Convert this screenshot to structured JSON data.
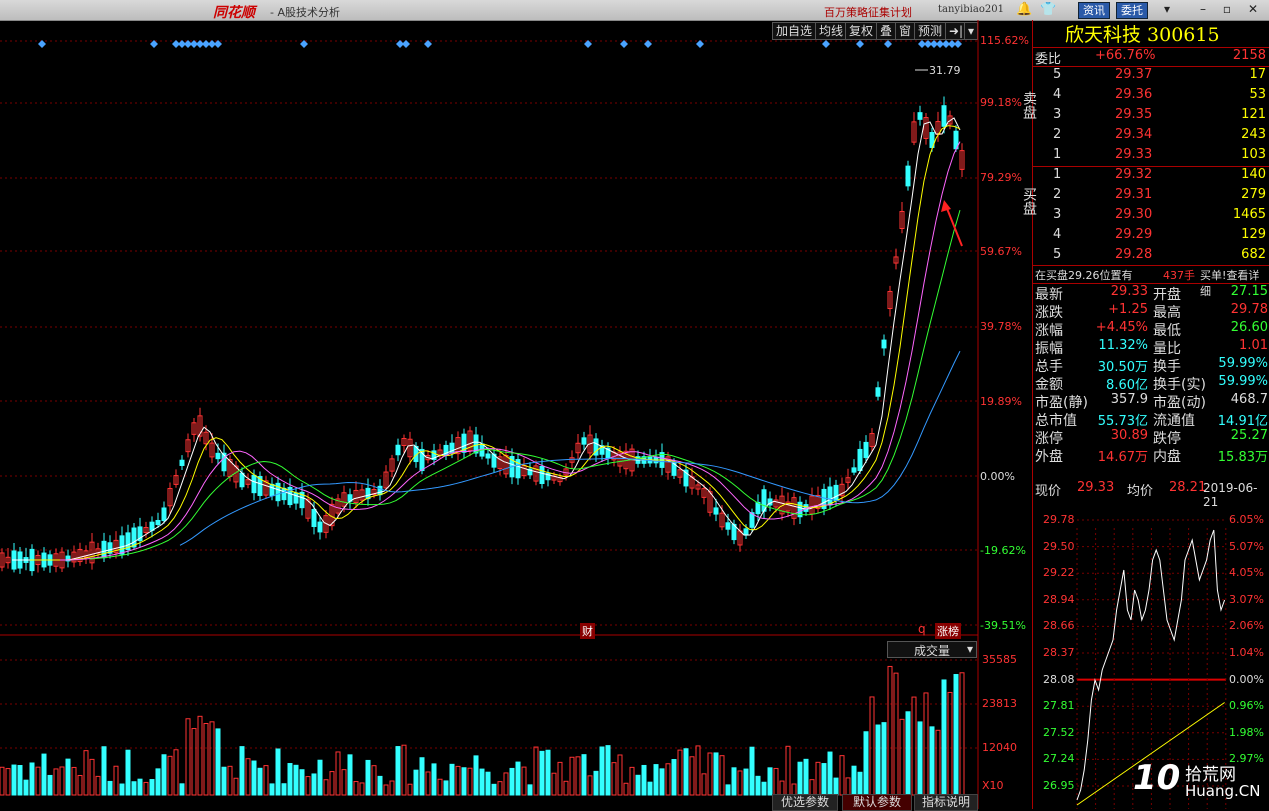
{
  "titlebar": {
    "brand": "同花顺",
    "app": "- A股技术分析",
    "promo": "百万策略征集计划",
    "user": "tanyibiao201",
    "btn_news": "资讯",
    "btn_order": "委托"
  },
  "toolbar": {
    "add_watch": "加自选",
    "ma": "均线",
    "restore": "复权",
    "overlay": "叠",
    "window": "窗",
    "forecast": "预测"
  },
  "main": {
    "pct_labels": [
      "115.62%",
      "99.18%",
      "79.29%",
      "59.67%",
      "39.78%",
      "19.89%",
      "0.00%",
      "-19.62%",
      "-39.51%"
    ],
    "high_label": "31.79",
    "marker_cai": "财",
    "marker_q": "q",
    "marker_zb": "涨榜"
  },
  "volume": {
    "selector": "成交量",
    "labels": [
      "35585",
      "23813",
      "12040"
    ],
    "unit": "X10"
  },
  "tabs": [
    "优选参数",
    "默认参数",
    "指标说明"
  ],
  "quote": {
    "name": "欣天科技 300615",
    "weibi_label": "委比",
    "weibi_pct": "+66.76%",
    "weibi_val": "2158",
    "sell_label": "卖盘",
    "buy_label": "买盘",
    "sells": [
      {
        "lv": "5",
        "price": "29.37",
        "vol": "17"
      },
      {
        "lv": "4",
        "price": "29.36",
        "vol": "53"
      },
      {
        "lv": "3",
        "price": "29.35",
        "vol": "121"
      },
      {
        "lv": "2",
        "price": "29.34",
        "vol": "243"
      },
      {
        "lv": "1",
        "price": "29.33",
        "vol": "103"
      }
    ],
    "buys": [
      {
        "lv": "1",
        "price": "29.32",
        "vol": "140"
      },
      {
        "lv": "2",
        "price": "29.31",
        "vol": "279"
      },
      {
        "lv": "3",
        "price": "29.30",
        "vol": "1465"
      },
      {
        "lv": "4",
        "price": "29.29",
        "vol": "129"
      },
      {
        "lv": "5",
        "price": "29.28",
        "vol": "682"
      }
    ],
    "notice": "在买盘29.26位置有",
    "notice_vol": "437手",
    "notice_action": "买单!查看详细",
    "stats": [
      {
        "k1": "最新",
        "v1": "29.33",
        "c1": "red",
        "k2": "开盘",
        "v2": "27.15",
        "c2": "grn"
      },
      {
        "k1": "涨跌",
        "v1": "+1.25",
        "c1": "red",
        "k2": "最高",
        "v2": "29.78",
        "c2": "red"
      },
      {
        "k1": "涨幅",
        "v1": "+4.45%",
        "c1": "red",
        "k2": "最低",
        "v2": "26.60",
        "c2": "grn"
      },
      {
        "k1": "振幅",
        "v1": "11.32%",
        "c1": "cyan",
        "k2": "量比",
        "v2": "1.01",
        "c2": "red"
      },
      {
        "k1": "总手",
        "v1": "30.50万",
        "c1": "cyan",
        "k2": "换手",
        "v2": "59.99%",
        "c2": "cyan"
      },
      {
        "k1": "金额",
        "v1": "8.60亿",
        "c1": "cyan",
        "k2": "换手(实)",
        "v2": "59.99%",
        "c2": "cyan"
      },
      {
        "k1": "市盈(静)",
        "v1": "357.9",
        "c1": "wht",
        "k2": "市盈(动)",
        "v2": "468.7",
        "c2": "wht"
      },
      {
        "k1": "总市值",
        "v1": "55.73亿",
        "c1": "cyan",
        "k2": "流通值",
        "v2": "14.91亿",
        "c2": "cyan"
      },
      {
        "k1": "涨停",
        "v1": "30.89",
        "c1": "red",
        "k2": "跌停",
        "v2": "25.27",
        "c2": "grn"
      },
      {
        "k1": "外盘",
        "v1": "14.67万",
        "c1": "red",
        "k2": "内盘",
        "v2": "15.83万",
        "c2": "grn"
      }
    ],
    "now_label": "现价",
    "now_val": "29.33",
    "avg_label": "均价",
    "avg_val": "28.21",
    "date": "2019-06-21"
  },
  "intraday": {
    "prices": [
      "29.78",
      "29.50",
      "29.22",
      "28.94",
      "28.66",
      "28.37",
      "28.08",
      "27.81",
      "27.52",
      "27.24",
      "26.95"
    ],
    "pcts": [
      "6.05%",
      "5.07%",
      "4.05%",
      "3.07%",
      "2.06%",
      "1.04%",
      "0.00%",
      "0.96%",
      "1.98%",
      "2.97%",
      ""
    ]
  },
  "watermark": {
    "num": "10",
    "site": "拾荒网",
    "url": "Huang.CN"
  },
  "colors": {
    "up": "#ff3333",
    "down": "#33ffff",
    "ma5": "#ffffff",
    "ma10": "#ffff00",
    "ma20": "#ff66ff",
    "ma30": "#33ff33",
    "ma60": "#3399ff"
  }
}
